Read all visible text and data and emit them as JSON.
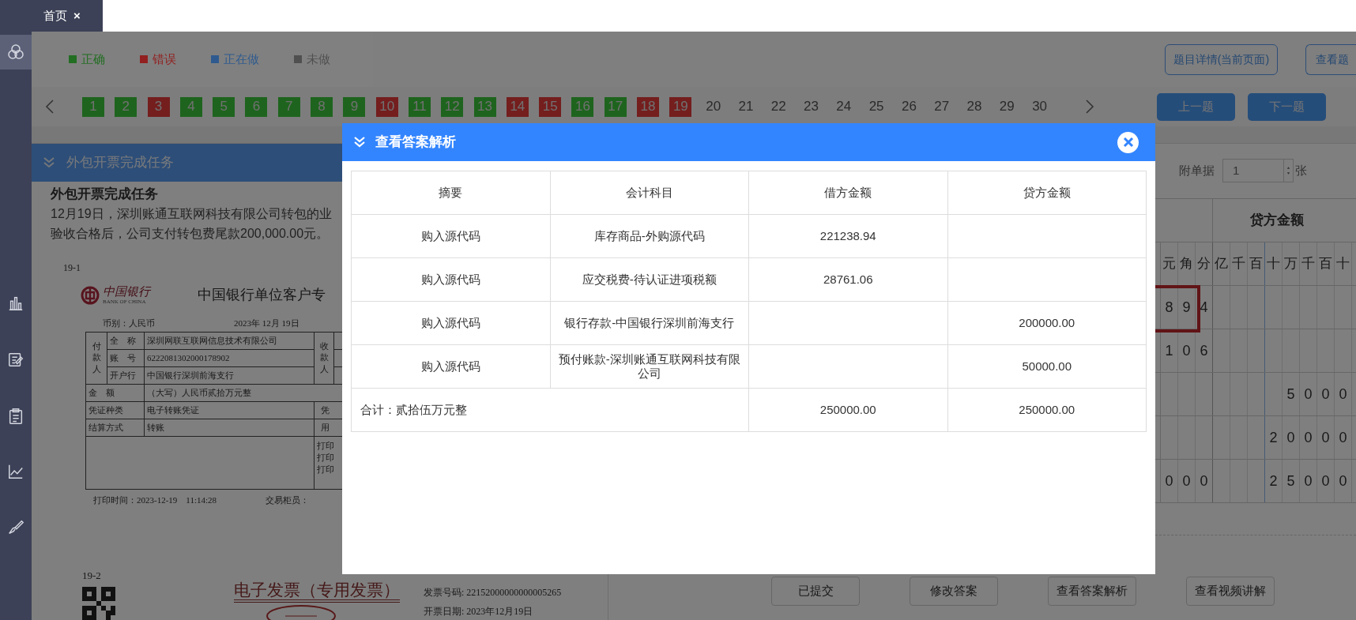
{
  "tabs": [
    {
      "label": "首页",
      "close": "×",
      "selected": true
    }
  ],
  "sidebar": {
    "items": [
      {
        "kind": "circles",
        "selected": true
      },
      {
        "kind": "bar-chart",
        "selected": false
      },
      {
        "kind": "edit",
        "selected": false
      },
      {
        "kind": "clipboard",
        "selected": false
      },
      {
        "kind": "line-chart",
        "selected": false
      },
      {
        "kind": "brush",
        "selected": false
      }
    ]
  },
  "legend": [
    {
      "label": "正确",
      "color": "#226e22"
    },
    {
      "label": "错误",
      "color": "#922020"
    },
    {
      "label": "正在做",
      "color": "#2e5a8f"
    },
    {
      "label": "未做",
      "color": "#505050"
    }
  ],
  "toolbar_buttons": [
    "题目详情(当前页面)",
    "查看题"
  ],
  "questions": [
    {
      "label": "1",
      "kind": "correct"
    },
    {
      "label": "2",
      "kind": "correct"
    },
    {
      "label": "3",
      "kind": "wrong"
    },
    {
      "label": "4",
      "kind": "correct"
    },
    {
      "label": "5",
      "kind": "correct"
    },
    {
      "label": "6",
      "kind": "correct"
    },
    {
      "label": "7",
      "kind": "correct"
    },
    {
      "label": "8",
      "kind": "correct"
    },
    {
      "label": "9",
      "kind": "correct"
    },
    {
      "label": "10",
      "kind": "wrong"
    },
    {
      "label": "11",
      "kind": "correct"
    },
    {
      "label": "12",
      "kind": "correct"
    },
    {
      "label": "13",
      "kind": "correct"
    },
    {
      "label": "14",
      "kind": "wrong"
    },
    {
      "label": "15",
      "kind": "wrong"
    },
    {
      "label": "16",
      "kind": "correct"
    },
    {
      "label": "17",
      "kind": "correct"
    },
    {
      "label": "18",
      "kind": "wrong"
    },
    {
      "label": "19",
      "kind": "wrong"
    },
    {
      "label": "20",
      "kind": "todo"
    },
    {
      "label": "21",
      "kind": "todo"
    },
    {
      "label": "22",
      "kind": "todo"
    },
    {
      "label": "23",
      "kind": "todo"
    },
    {
      "label": "24",
      "kind": "todo"
    },
    {
      "label": "25",
      "kind": "todo"
    },
    {
      "label": "26",
      "kind": "todo"
    },
    {
      "label": "27",
      "kind": "todo"
    },
    {
      "label": "28",
      "kind": "todo"
    },
    {
      "label": "29",
      "kind": "todo"
    },
    {
      "label": "30",
      "kind": "todo"
    }
  ],
  "nav_buttons": [
    "上一题",
    "下一题"
  ],
  "task_panel": {
    "header": "外包开票完成任务",
    "title": "外包开票完成任务",
    "description": [
      "12月19日，深圳账通互联网科技有限公司转包的业",
      "验收合格后，公司支付转包费尾款200,000.00元。"
    ]
  },
  "receipt": {
    "number": "19-1",
    "bank_name": "中国银行",
    "bank_name_en": "BANK OF CHINA",
    "title": "中国银行单位客户专",
    "currency": "币别：人民币",
    "date": "2023年 12月 19日",
    "payer_label": "付款人",
    "payee_label": "收款人",
    "fields": [
      {
        "label": "全　称",
        "value": "深圳网联互联网信息技术有限公司"
      },
      {
        "label": "账　号",
        "value": "6222081302000178902"
      },
      {
        "label": "开户行",
        "value": "中国银行深圳前海支行"
      }
    ],
    "amount_label": "金　额",
    "amount": "（大写）人民币贰拾万元整",
    "voucher_type_label": "凭证种类",
    "voucher_type": "电子转账凭证",
    "voucher_cut": "凭",
    "settlement_label": "结算方式",
    "settlement": "转账",
    "purpose_cut": "用",
    "print_lines": [
      "打印",
      "打印",
      "打印"
    ],
    "print_time": "打印时间：2023-12-19　11:14:28",
    "teller": "交易柜员："
  },
  "invoice": {
    "number": "19-2",
    "title": "电子发票（专用发票）",
    "invoice_no": "发票号码: 22152000000000005265",
    "date": "开票日期: 2023年12月19日"
  },
  "voucher": {
    "attachments_label": "附单据",
    "attachments_value": "1",
    "attachments_unit": "张",
    "credit_header": "贷方金额",
    "digit_units": [
      "元",
      "角",
      "分",
      "亿",
      "千",
      "百",
      "十",
      "万",
      "千",
      "百",
      "十"
    ],
    "digit_rows": [
      [
        "8",
        "9",
        "4",
        null,
        null,
        null,
        null,
        null,
        null,
        null,
        null
      ],
      [
        "1",
        "0",
        "6",
        null,
        null,
        null,
        null,
        null,
        null,
        null,
        null
      ],
      [
        null,
        null,
        null,
        null,
        null,
        null,
        null,
        "5",
        "0",
        "0",
        "0"
      ],
      [
        null,
        null,
        null,
        null,
        null,
        null,
        "2",
        "0",
        "0",
        "0",
        "0"
      ],
      [
        "0",
        "0",
        "0",
        null,
        null,
        null,
        "2",
        "5",
        "0",
        "0",
        "0"
      ]
    ]
  },
  "action_buttons": [
    "已提交",
    "修改答案",
    "查看答案解析",
    "查看视频讲解"
  ],
  "modal": {
    "title": "查看答案解析",
    "table": {
      "columns": [
        "摘要",
        "会计科目",
        "借方金额",
        "贷方金额"
      ],
      "rows": [
        [
          "购入源代码",
          "库存商品-外购源代码",
          "221238.94",
          null
        ],
        [
          "购入源代码",
          "应交税费-待认证进项税额",
          "28761.06",
          null
        ],
        [
          "购入源代码",
          "银行存款-中国银行深圳前海支行",
          null,
          "200000.00"
        ],
        [
          "购入源代码",
          "预付账款-深圳账通互联网科技有限公司",
          null,
          "50000.00"
        ]
      ],
      "total": {
        "label": "合计：贰拾伍万元整",
        "debit": "250000.00",
        "credit": "250000.00"
      }
    }
  }
}
